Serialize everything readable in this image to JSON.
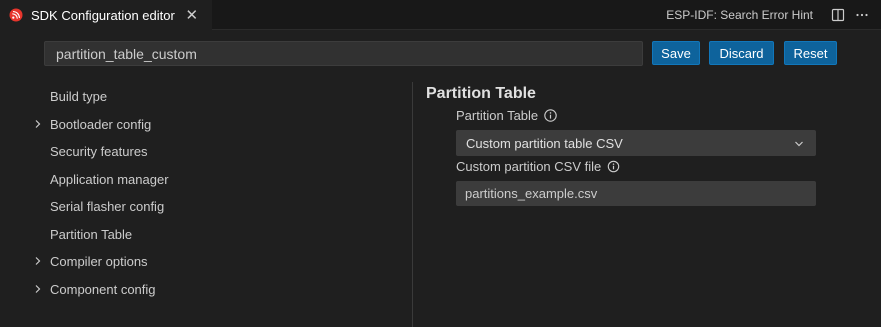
{
  "tab": {
    "title": "SDK Configuration editor",
    "close_glyph": "✕",
    "logo_icon": "espressif-logo-icon",
    "logo_color": "#e7352c"
  },
  "header_actions": {
    "hint_link": "ESP-IDF: Search Error Hint",
    "split_icon": "split-editor-icon",
    "more_icon": "more-actions-icon"
  },
  "search": {
    "value": "partition_table_custom"
  },
  "buttons": {
    "save": "Save",
    "discard": "Discard",
    "reset": "Reset"
  },
  "colors": {
    "accent": "#0e639c",
    "background": "#1f1f1f",
    "input_bg": "#3c3c3c"
  },
  "sidebar": {
    "items": [
      {
        "label": "Build type",
        "expandable": false
      },
      {
        "label": "Bootloader config",
        "expandable": true
      },
      {
        "label": "Security features",
        "expandable": false
      },
      {
        "label": "Application manager",
        "expandable": false
      },
      {
        "label": "Serial flasher config",
        "expandable": false
      },
      {
        "label": "Partition Table",
        "expandable": false
      },
      {
        "label": "Compiler options",
        "expandable": true
      },
      {
        "label": "Component config",
        "expandable": true
      }
    ]
  },
  "main": {
    "section_title": "Partition Table",
    "partition_table": {
      "label": "Partition Table",
      "selected": "Custom partition table CSV"
    },
    "custom_csv": {
      "label": "Custom partition CSV file",
      "value": "partitions_example.csv"
    }
  }
}
